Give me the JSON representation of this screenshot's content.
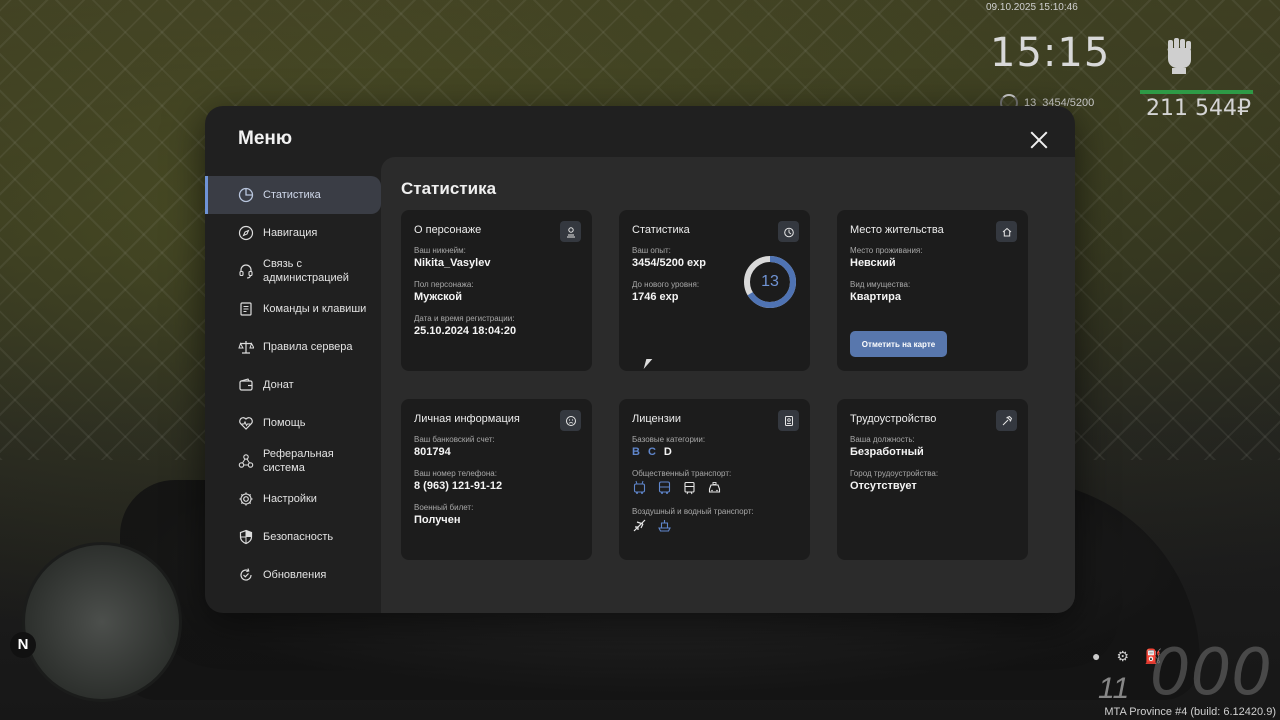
{
  "hud": {
    "datetime": "09.10.2025 15:10:46",
    "clock": "15:15",
    "level": "13",
    "exp": "3454/5200",
    "money": "211 544₽",
    "gear": "11",
    "speed": "000",
    "north": "N",
    "build": "MTA Province #4 (build: 6.12420.9)"
  },
  "menu": {
    "title": "Меню",
    "sidebar": [
      {
        "label": "Статистика",
        "icon": "pie-chart-icon",
        "active": true
      },
      {
        "label": "Навигация",
        "icon": "compass-icon"
      },
      {
        "label": "Связь с администрацией",
        "icon": "headset-icon"
      },
      {
        "label": "Команды и клавиши",
        "icon": "document-icon"
      },
      {
        "label": "Правила сервера",
        "icon": "scales-icon"
      },
      {
        "label": "Донат",
        "icon": "wallet-icon"
      },
      {
        "label": "Помощь",
        "icon": "heart-icon"
      },
      {
        "label": "Реферальная система",
        "icon": "network-icon"
      },
      {
        "label": "Настройки",
        "icon": "gear-icon"
      },
      {
        "label": "Безопасность",
        "icon": "shield-icon"
      },
      {
        "label": "Обновления",
        "icon": "update-icon"
      }
    ],
    "content_title": "Статистика"
  },
  "cards": {
    "character": {
      "title": "О персонаже",
      "nick_label": "Ваш никнейм:",
      "nick": "Nikita_Vasylev",
      "gender_label": "Пол персонажа:",
      "gender": "Мужской",
      "reg_label": "Дата и время регистрации:",
      "reg": "25.10.2024 18:04:20"
    },
    "stats": {
      "title": "Статистика",
      "exp_label": "Ваш опыт:",
      "exp": "3454/5200 exp",
      "next_label": "До нового уровня:",
      "next": "1746 exp",
      "level": "13",
      "progress": 0.664,
      "accent": "#6f93d4"
    },
    "residence": {
      "title": "Место жительства",
      "place_label": "Место проживания:",
      "place": "Невский",
      "type_label": "Вид имущества:",
      "type": "Квартира",
      "button": "Отметить на карте"
    },
    "personal": {
      "title": "Личная информация",
      "bank_label": "Ваш банковский счет:",
      "bank": "801794",
      "phone_label": "Ваш номер телефона:",
      "phone": "8 (963) 121-91-12",
      "military_label": "Военный билет:",
      "military": "Получен"
    },
    "licenses": {
      "title": "Лицензии",
      "base_label": "Базовые категории:",
      "categories": [
        "B",
        "C",
        "D"
      ],
      "public_label": "Общественный транспорт:",
      "air_label": "Воздушный и водный транспорт:"
    },
    "job": {
      "title": "Трудоустройство",
      "position_label": "Ваша должность:",
      "position": "Безработный",
      "city_label": "Город трудоустройства:",
      "city": "Отсутствует"
    }
  }
}
